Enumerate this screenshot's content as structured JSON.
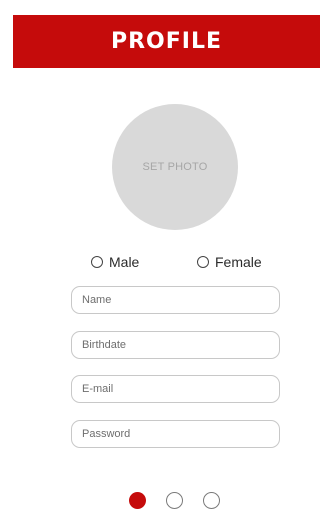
{
  "header": {
    "title": "PROFILE"
  },
  "photo": {
    "label": "SET PHOTO"
  },
  "gender": {
    "options": [
      {
        "label": "Male",
        "selected": false
      },
      {
        "label": "Female",
        "selected": false
      }
    ]
  },
  "form": {
    "name_placeholder": "Name",
    "birthdate_placeholder": "Birthdate",
    "email_placeholder": "E-mail",
    "password_placeholder": "Password"
  },
  "pager": {
    "total_pages": 3,
    "current_page": 1
  },
  "colors": {
    "accent": "#c50b0b",
    "photo_bg": "#d9d9d9"
  }
}
